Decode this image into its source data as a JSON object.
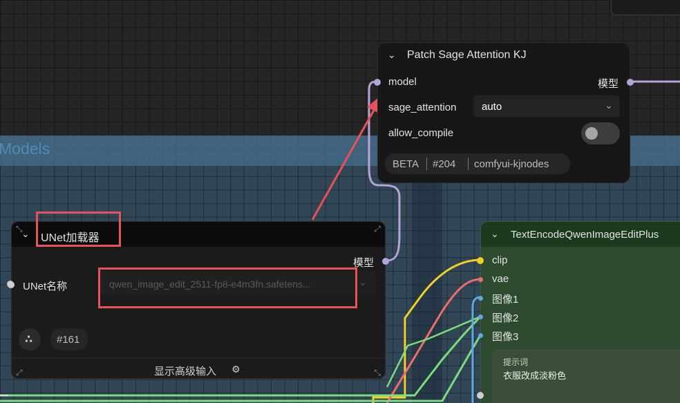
{
  "group": {
    "title": "Models",
    "color": "#3e627e"
  },
  "patch_node": {
    "title": "Patch Sage Attention KJ",
    "inputs": {
      "model": "model",
      "sage_attention": "sage_attention",
      "allow_compile": "allow_compile"
    },
    "output": "模型",
    "sage_attention_value": "auto",
    "allow_compile_on": false,
    "badges": [
      "BETA",
      "#204",
      "comfyui-kjnodes"
    ]
  },
  "unet_node": {
    "title": "UNet加载器",
    "output": "模型",
    "unet_name_label": "UNet名称",
    "unet_name_value": "qwen_image_edit_2511-fp8-e4m3fn.safetens...",
    "id_badge": "#161",
    "advanced_label": "显示高级输入"
  },
  "text_node": {
    "title": "TextEncodeQwenImageEditPlus",
    "inputs": [
      "clip",
      "vae",
      "图像1",
      "图像2",
      "图像3"
    ],
    "prompt_label": "提示词",
    "prompt_value": "衣服改成淡粉色",
    "color": "#2e4a2e"
  },
  "colors": {
    "model_wire": "#b6a4d8",
    "clip_wire": "#f2d02a",
    "vae_wire": "#ee6e6e",
    "image_wire": "#5fa8e0",
    "green_wire": "#7ddd7a",
    "highlight": "#e8525a"
  }
}
